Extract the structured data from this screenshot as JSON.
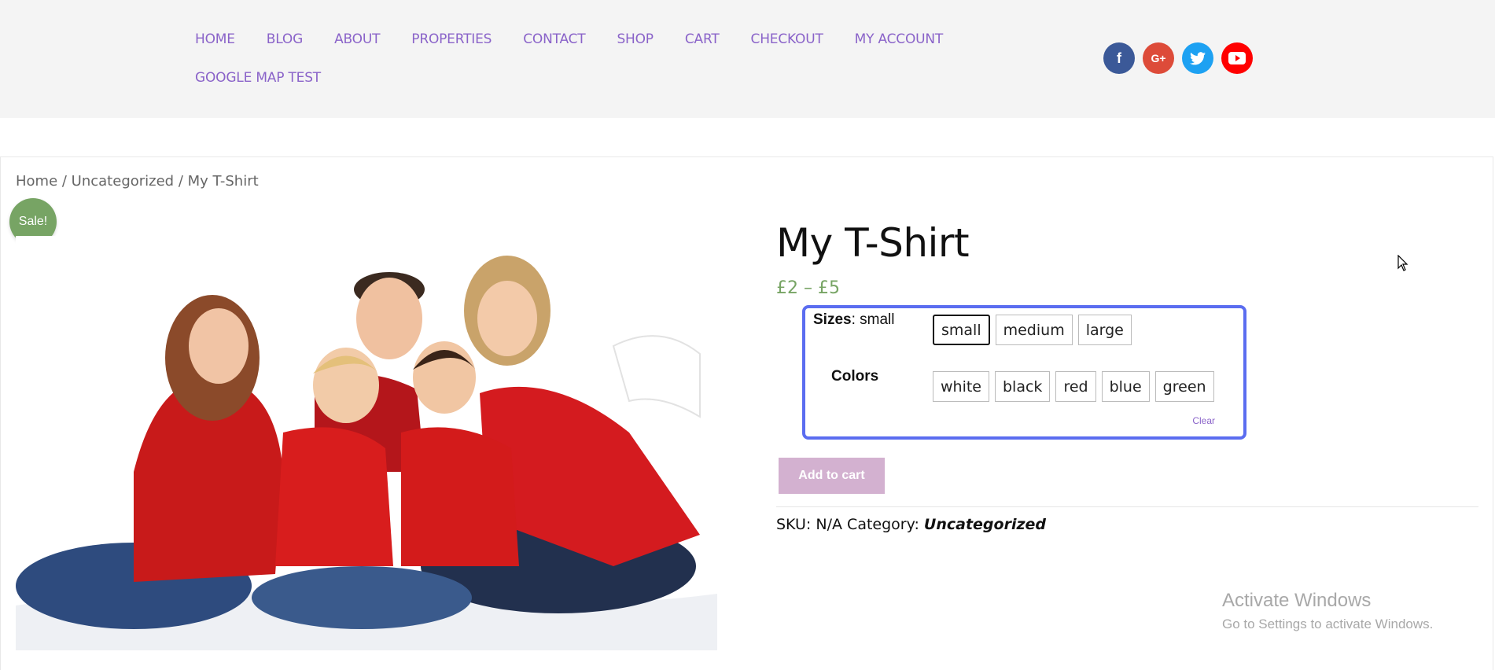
{
  "nav": {
    "items": [
      "HOME",
      "BLOG",
      "ABOUT",
      "PROPERTIES",
      "CONTACT",
      "SHOP",
      "CART",
      "CHECKOUT",
      "MY ACCOUNT",
      "GOOGLE MAP TEST"
    ]
  },
  "social": {
    "icons": [
      "facebook-icon",
      "google-plus-icon",
      "twitter-icon",
      "youtube-icon"
    ],
    "facebook_glyph": "f",
    "google_glyph": "G+"
  },
  "breadcrumb": {
    "home": "Home",
    "category": "Uncategorized",
    "current": "My T-Shirt",
    "separator": " / "
  },
  "product": {
    "sale_badge": "Sale!",
    "title": "My T-Shirt",
    "price": "£2 – £5",
    "image_alt": "Family of four in red sweaters"
  },
  "variations": {
    "sizes_label": "Sizes",
    "sizes_selected": ": small",
    "sizes": [
      "small",
      "medium",
      "large"
    ],
    "colors_label": "Colors",
    "colors": [
      "white",
      "black",
      "red",
      "blue",
      "green"
    ],
    "clear": "Clear"
  },
  "cart": {
    "add_to_cart": "Add to cart"
  },
  "meta": {
    "sku_label": "SKU:",
    "sku_value": "N/A",
    "category_label": "Category:",
    "category_value": "Uncategorized"
  },
  "watermark": {
    "line1": "Activate Windows",
    "line2": "Go to Settings to activate Windows."
  },
  "colors": {
    "nav": "#8a63c9",
    "price": "#77a464",
    "sale_badge": "#77a464",
    "highlight_border": "#5b6df0",
    "add_to_cart": "#d3b1d0"
  }
}
